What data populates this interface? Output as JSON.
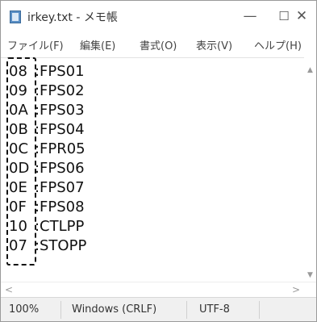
{
  "window": {
    "title": "irkey.txt - メモ帳",
    "minimize_glyph": "—",
    "maximize_glyph": "☐",
    "close_glyph": "✕"
  },
  "menu": {
    "items": [
      {
        "label": "ファイル(F)"
      },
      {
        "label": "編集(E)"
      },
      {
        "label": "書式(O)"
      },
      {
        "label": "表示(V)"
      },
      {
        "label": "ヘルプ(H)"
      }
    ]
  },
  "editor": {
    "lines": [
      {
        "code": "08",
        "sep": ":",
        "name": "FPS01"
      },
      {
        "code": "09",
        "sep": ":",
        "name": "FPS02"
      },
      {
        "code": "0A",
        "sep": ":",
        "name": "FPS03"
      },
      {
        "code": "0B",
        "sep": ":",
        "name": "FPS04"
      },
      {
        "code": "0C",
        "sep": ":",
        "name": "FPR05"
      },
      {
        "code": "0D",
        "sep": ":",
        "name": "FPS06"
      },
      {
        "code": "0E",
        "sep": ":",
        "name": "FPS07"
      },
      {
        "code": "0F",
        "sep": ":",
        "name": "FPS08"
      },
      {
        "code": "10",
        "sep": ":",
        "name": "CTLPP"
      },
      {
        "code": "07",
        "sep": ":",
        "name": "STOPP"
      }
    ]
  },
  "scrollbars": {
    "up_glyph": "▲",
    "down_glyph": "▼",
    "left_glyph": "<",
    "right_glyph": ">"
  },
  "status": {
    "zoom": "100%",
    "line_ending": "Windows (CRLF)",
    "encoding": "UTF-8"
  },
  "colors": {
    "app_icon": "#5a8fc6",
    "text": "#111111",
    "status_bg": "#f0f0f0"
  },
  "icons": {
    "app": "notepad-icon"
  }
}
